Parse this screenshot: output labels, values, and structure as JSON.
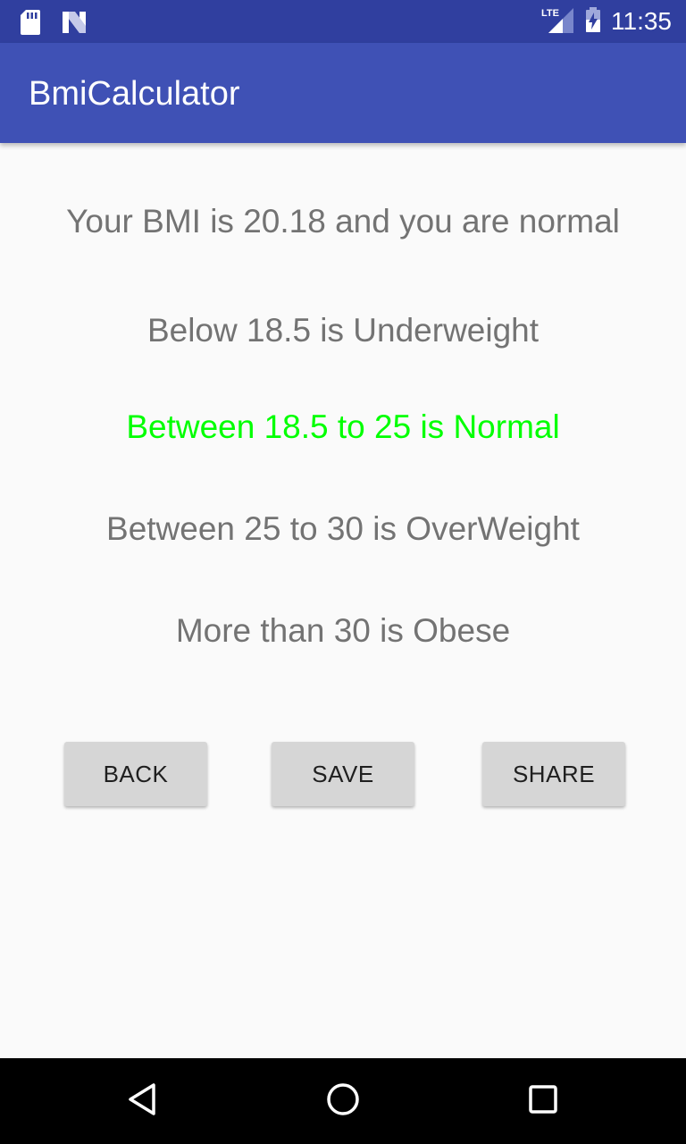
{
  "status_bar": {
    "time": "11:35",
    "network_label": "LTE",
    "icons": [
      "sd-card-icon",
      "notification-n-icon",
      "lte-signal-icon",
      "battery-icon"
    ]
  },
  "app_bar": {
    "title": "BmiCalculator"
  },
  "result": {
    "summary": "Your BMI is 20.18 and you are normal"
  },
  "categories": [
    {
      "label": "Below 18.5 is Underweight",
      "highlighted": false
    },
    {
      "label": "Between 18.5 to 25 is Normal",
      "highlighted": true
    },
    {
      "label": "Between 25 to 30 is OverWeight",
      "highlighted": false
    },
    {
      "label": "More than 30 is Obese",
      "highlighted": false
    }
  ],
  "buttons": {
    "back": "BACK",
    "save": "SAVE",
    "share": "SHARE"
  },
  "nav_bar": {
    "icons": [
      "back-triangle-icon",
      "home-circle-icon",
      "recents-square-icon"
    ]
  },
  "colors": {
    "status_bar": "#303f9f",
    "app_bar": "#3f51b5",
    "highlight": "#00ff00",
    "text_gray": "#737373",
    "button_bg": "#d6d6d6"
  }
}
